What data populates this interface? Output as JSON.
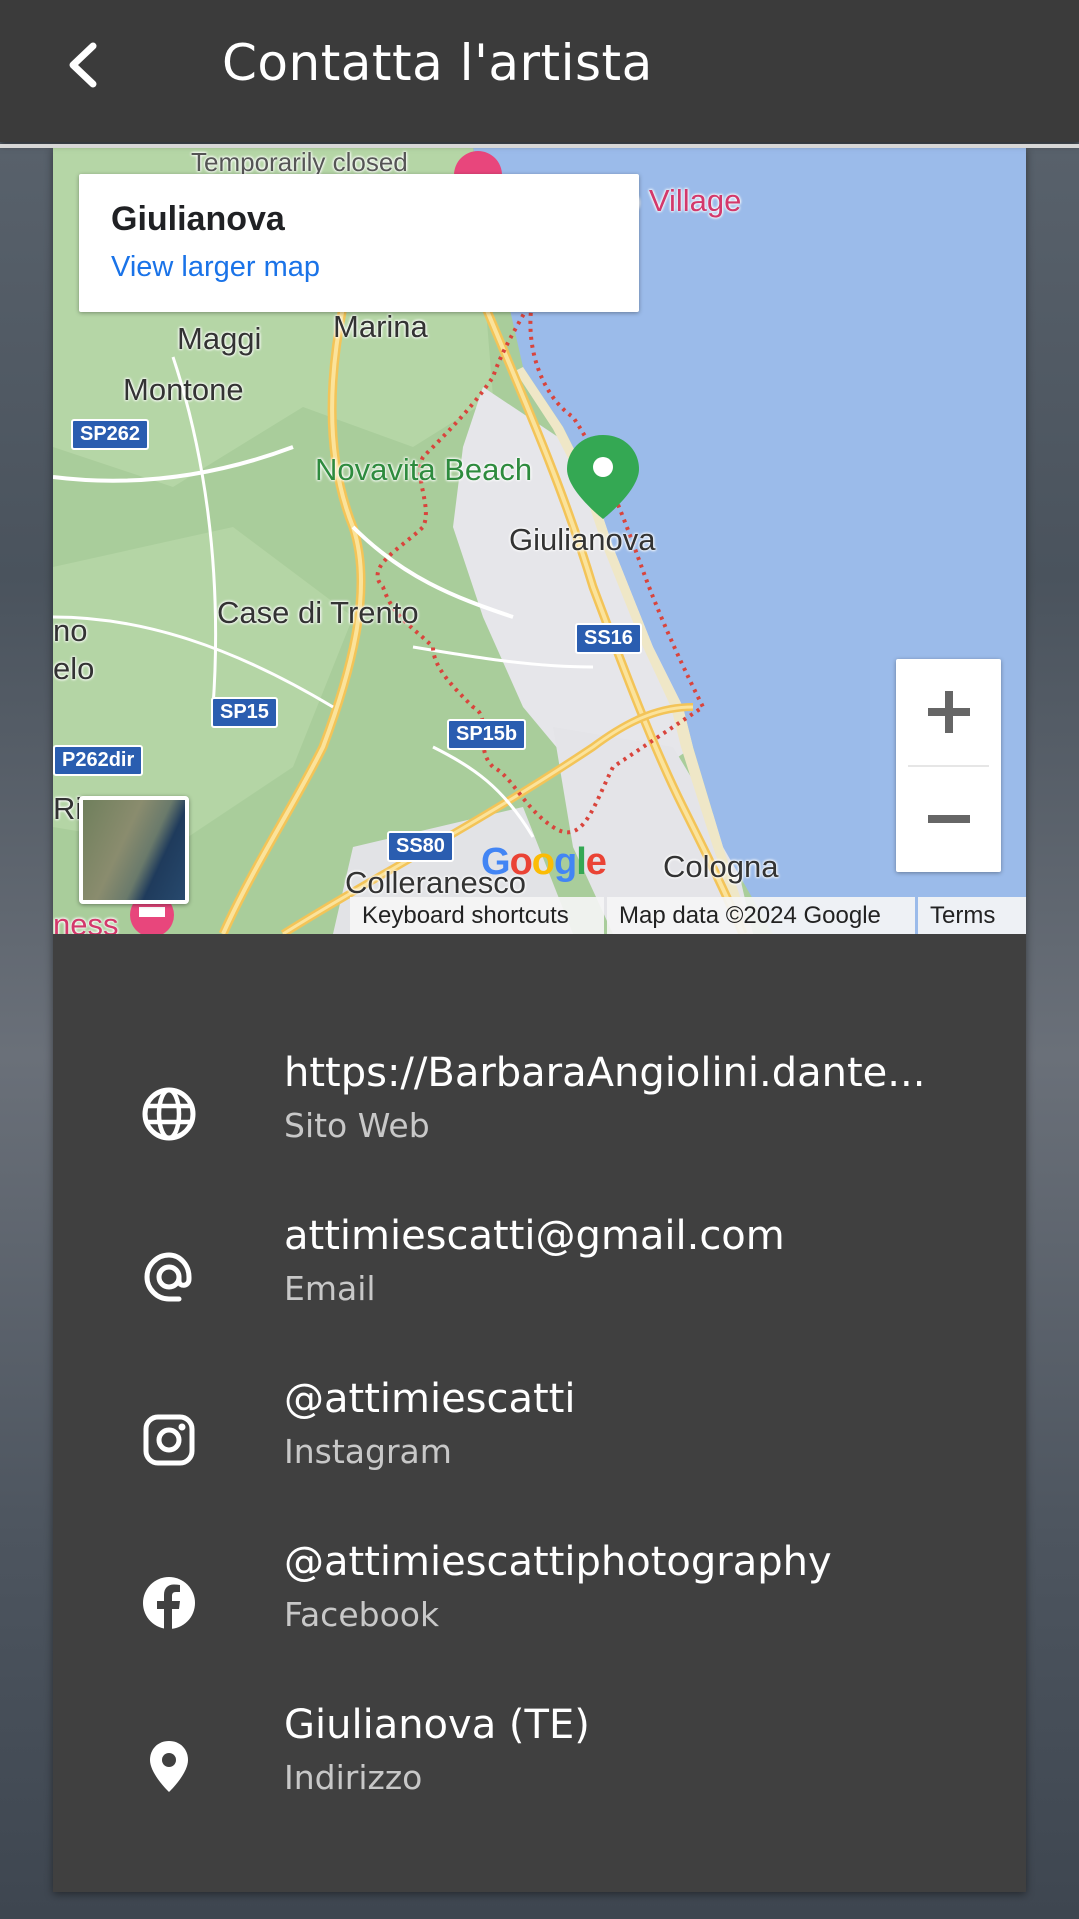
{
  "app_bar": {
    "title": "Contatta l'artista"
  },
  "map": {
    "info_box": {
      "place": "Giulianova",
      "link": "View larger map"
    },
    "labels": {
      "temporarily_closed": "Temporarily closed",
      "village": "o Village",
      "maggi": "Maggi",
      "marina": "Marina",
      "montone": "Montone",
      "novavita": "Novavita Beach",
      "giulianova": "Giulianova",
      "case_di_trento": "Case di Trento",
      "colleranesco": "Colleranesco",
      "cologna": "Cologna",
      "no": "no",
      "elo": "elo",
      "ri": "Ri",
      "ness": "ness"
    },
    "shields": {
      "sp262": "SP262",
      "ss16": "SS16",
      "sp15": "SP15",
      "sp15b": "SP15b",
      "sp262dir": "P262dir",
      "ss80": "SS80"
    },
    "google": "Google",
    "attribution": {
      "shortcuts": "Keyboard shortcuts",
      "data": "Map data ©2024 Google",
      "terms": "Terms"
    },
    "colors": {
      "sea": "#9bbbea",
      "land": "#a9cd9b",
      "road": "#f5c65a",
      "boundary": "#d9443c",
      "pin": "#34a853"
    }
  },
  "contacts": [
    {
      "icon": "globe-icon",
      "value": "https://BarbaraAngiolini.dante...",
      "type": "Sito Web"
    },
    {
      "icon": "at-sign-icon",
      "value": "attimiescatti@gmail.com",
      "type": "Email"
    },
    {
      "icon": "instagram-icon",
      "value": "@attimiescatti",
      "type": "Instagram"
    },
    {
      "icon": "facebook-icon",
      "value": "@attimiescattiphotography",
      "type": "Facebook"
    },
    {
      "icon": "location-pin-icon",
      "value": "Giulianova (TE)",
      "type": "Indirizzo"
    }
  ]
}
